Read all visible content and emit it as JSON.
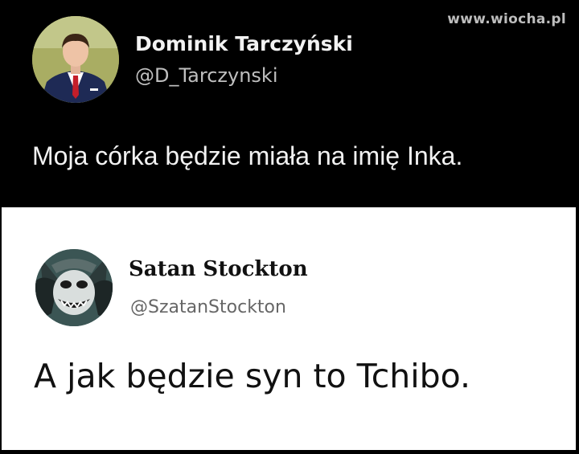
{
  "watermark": "www.wiocha.pl",
  "tweet1": {
    "name": "Dominik Tarczyński",
    "handle": "@D_Tarczynski",
    "text": "Moja córka będzie miała na imię Inka.",
    "avatar_icon": "man-in-suit-avatar"
  },
  "tweet2": {
    "name": "Satan Stockton",
    "handle": "@SzatanStockton",
    "text": "A jak będzie syn to Tchibo.",
    "avatar_icon": "joker-face-avatar"
  },
  "colors": {
    "top_background": "#000000",
    "bottom_background": "#ffffff",
    "primary_text_dark": "#f2f2f2",
    "secondary_text_dark": "#bfbfbf"
  }
}
